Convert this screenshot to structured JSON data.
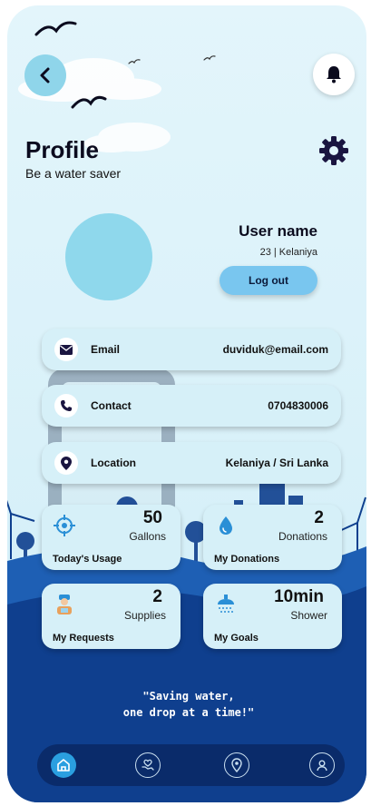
{
  "header": {
    "title": "Profile",
    "subtitle": "Be a water saver",
    "back_icon": "chevron-left-icon",
    "notification_icon": "bell-icon",
    "settings_icon": "gear-icon"
  },
  "user": {
    "name": "User name",
    "info": "23 | Kelaniya",
    "logout_label": "Log out"
  },
  "details": [
    {
      "icon": "mail-icon",
      "label": "Email",
      "value": "duviduk@email.com"
    },
    {
      "icon": "phone-icon",
      "label": "Contact",
      "value": "0704830006"
    },
    {
      "icon": "location-pin-icon",
      "label": "Location",
      "value": "Kelaniya / Sri Lanka"
    }
  ],
  "stats": [
    {
      "icon": "target-icon",
      "value": "50",
      "unit": "Gallons",
      "label": "Today's Usage"
    },
    {
      "icon": "water-drop-icon",
      "value": "2",
      "unit": "Donations",
      "label": "My Donations"
    },
    {
      "icon": "delivery-person-icon",
      "value": "2",
      "unit": "Supplies",
      "label": "My Requests"
    },
    {
      "icon": "shower-icon",
      "value": "10min",
      "unit": "Shower",
      "label": "My Goals"
    }
  ],
  "quote": {
    "line1": "\"Saving water,",
    "line2": "one drop at a time!\""
  },
  "nav": [
    {
      "icon": "home-icon",
      "active": true
    },
    {
      "icon": "heart-hand-icon",
      "active": false
    },
    {
      "icon": "map-pin-icon",
      "active": false
    },
    {
      "icon": "user-icon",
      "active": false
    }
  ],
  "colors": {
    "sky": "#e3f5fb",
    "accent": "#8fd5ea",
    "card": "#d6f0f8",
    "wave_dark": "#0f3f8e",
    "navbar": "#0a2b6a",
    "logout": "#79c6ef"
  }
}
